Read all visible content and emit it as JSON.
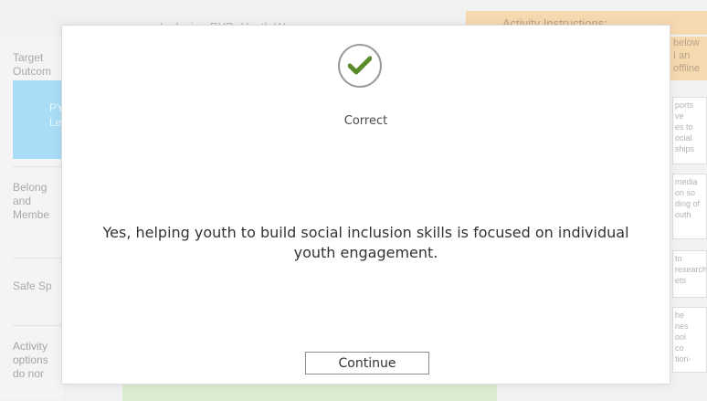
{
  "background": {
    "top_title": "Inclusion PYD: Youth W...",
    "instructions_header": "Activity Instructions:",
    "instructions_side": "below\nI an\noffline",
    "left_rows": {
      "target": "Target\nOutcom",
      "blue": "PY\nLeve",
      "belonging": "Belong\nand\nMembe",
      "safe": "Safe Sp",
      "activity": "Activity\noptions\ndo nor"
    },
    "right_cards": [
      "ports\nve\nes to\nocial\nships",
      "media\non so\nding of\nouth",
      "to\nresearch\nets",
      "he\nnes\nool\nco\ntion-"
    ]
  },
  "modal": {
    "status_icon": "checkmark-icon",
    "status_color": "#5a8a2a",
    "status_title": "Correct",
    "message": "Yes, helping youth to build social inclusion skills is focused on individual youth engagement.",
    "continue_label": "Continue"
  }
}
